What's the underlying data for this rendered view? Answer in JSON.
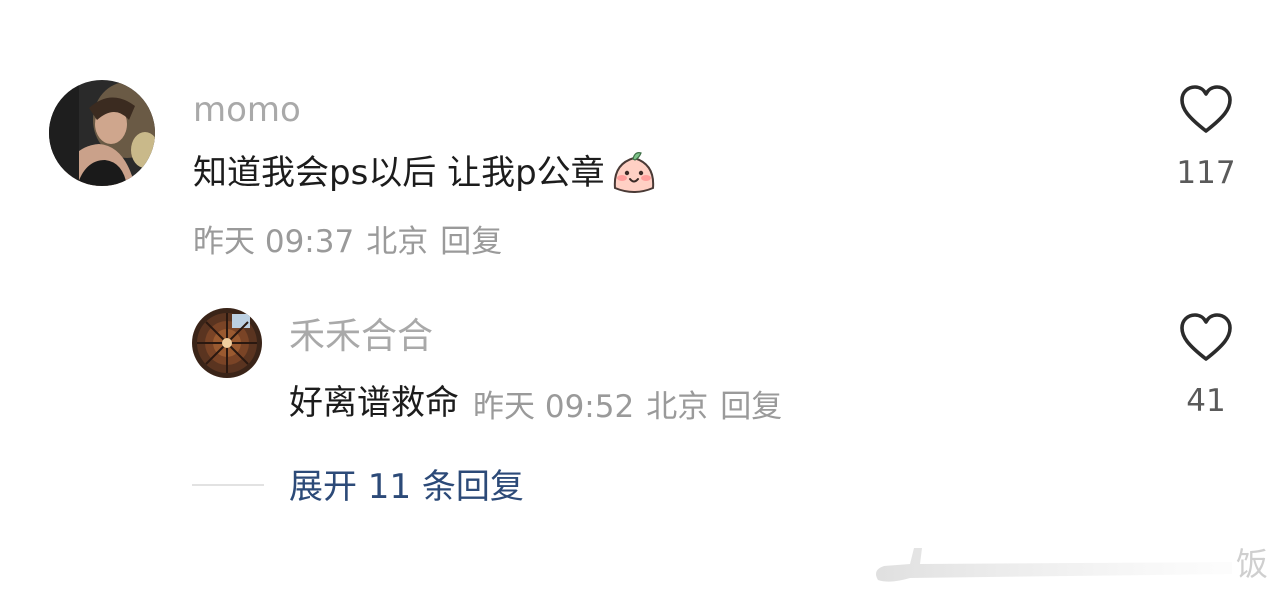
{
  "comment": {
    "username": "momo",
    "text": "知道我会ps以后 让我p公章",
    "emoji_icon": "pink-bun-face-emoji",
    "time": "昨天 09:37",
    "location": "北京",
    "reply_label": "回复",
    "likes": "117"
  },
  "reply": {
    "username": "禾禾合合",
    "text": "好离谱救命",
    "time": "昨天 09:52",
    "location": "北京",
    "reply_label": "回复",
    "likes": "41"
  },
  "expand": {
    "label": "展开 11 条回复"
  },
  "watermark": {
    "text": "饭"
  },
  "colors": {
    "username": "#a9a9a9",
    "content": "#1c1c1c",
    "meta": "#9a9a9a",
    "expand_link": "#2c4a78",
    "heart_outline": "#2b2b2b"
  }
}
